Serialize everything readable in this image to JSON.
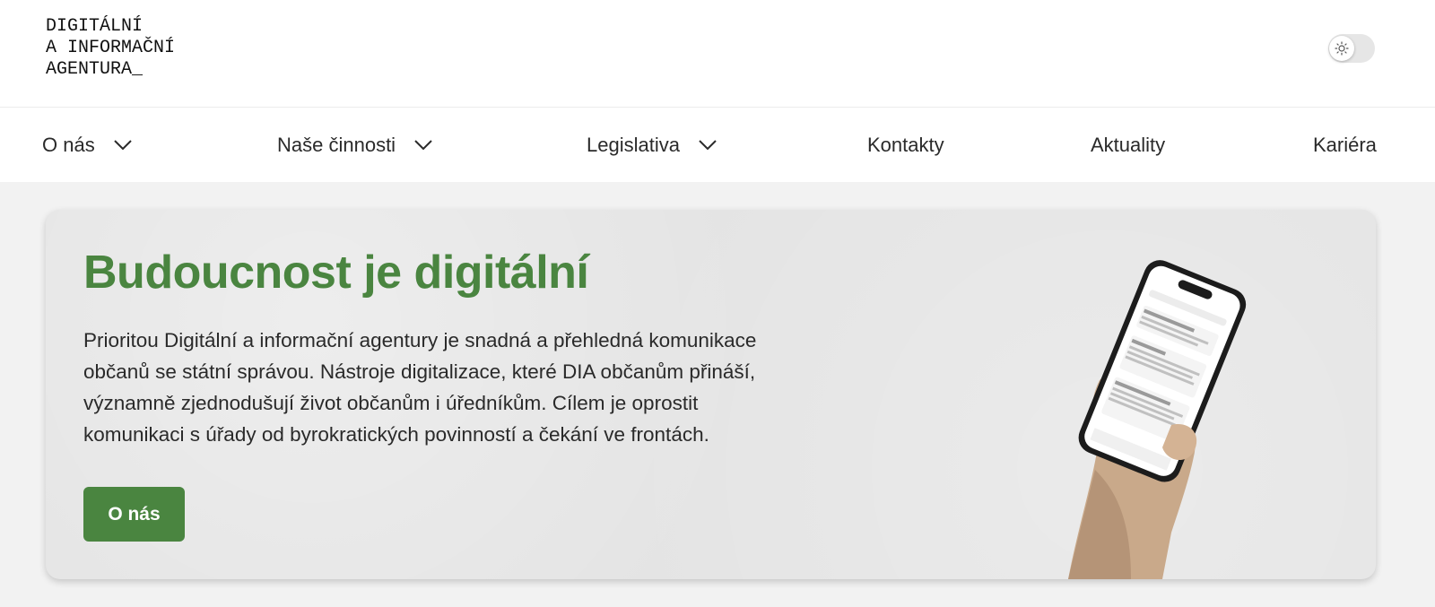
{
  "header": {
    "logo_lines": [
      "DIGITÁLNÍ",
      "A INFORMAČNÍ",
      "AGENTURA_"
    ],
    "theme_toggle_icon": "sun-icon"
  },
  "nav": {
    "items": [
      {
        "label": "O nás",
        "has_dropdown": true
      },
      {
        "label": "Naše činnosti",
        "has_dropdown": true
      },
      {
        "label": "Legislativa",
        "has_dropdown": true
      },
      {
        "label": "Kontakty",
        "has_dropdown": false
      },
      {
        "label": "Aktuality",
        "has_dropdown": false
      },
      {
        "label": "Kariéra",
        "has_dropdown": false
      }
    ]
  },
  "hero": {
    "title": "Budoucnost je digitální",
    "text_lines": [
      "Prioritou Digitální a informační agentury je snadná a přehledná komunikace",
      "občanů se státní správou. Nástroje digitalizace, které DIA občanům přináší,",
      "významně zjednodušují život občanům i úředníkům. Cílem je oprostit",
      "komunikaci s úřady od byrokratických povinností a čekání ve frontách."
    ],
    "button_label": "O nás",
    "image": "hand-holding-phone-illustration"
  },
  "colors": {
    "accent_green": "#4a8540",
    "page_background": "#f2f2f2",
    "hero_background": "#e4e4e4"
  }
}
